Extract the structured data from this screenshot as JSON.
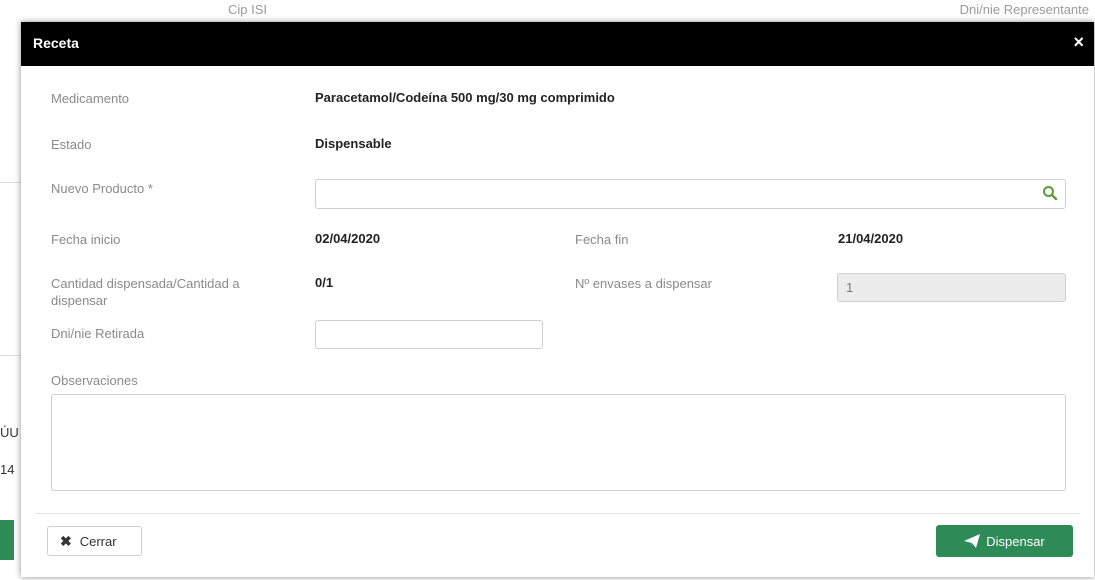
{
  "background": {
    "top_label_left": "Cip ISI",
    "top_label_right": "Dni/nie Representante",
    "side_fragment_1": "ÚU",
    "side_fragment_2": "14"
  },
  "modal": {
    "title": "Receta",
    "close_symbol": "×",
    "fields": {
      "medicamento_label": "Medicamento",
      "medicamento_value": "Paracetamol/Codeína 500 mg/30 mg comprimido",
      "estado_label": "Estado",
      "estado_value": "Dispensable",
      "nuevo_producto_label": "Nuevo Producto *",
      "nuevo_producto_value": "",
      "fecha_inicio_label": "Fecha inicio",
      "fecha_inicio_value": "02/04/2020",
      "fecha_fin_label": "Fecha fin",
      "fecha_fin_value": "21/04/2020",
      "cantidad_label": "Cantidad dispensada/Cantidad a dispensar",
      "cantidad_value": "0/1",
      "envases_label": "Nº envases a dispensar",
      "envases_value": "1",
      "dni_retirada_label": "Dni/nie Retirada",
      "dni_retirada_value": "",
      "observaciones_label": "Observaciones",
      "observaciones_value": ""
    },
    "footer": {
      "cerrar_label": "Cerrar",
      "dispensar_label": "Dispensar"
    },
    "colors": {
      "header_bg": "#000000",
      "primary_button": "#2e8b57",
      "search_icon": "#5a9a3a"
    },
    "icons": {
      "search": "search-icon",
      "close": "close-icon",
      "send": "paper-plane-icon"
    }
  }
}
